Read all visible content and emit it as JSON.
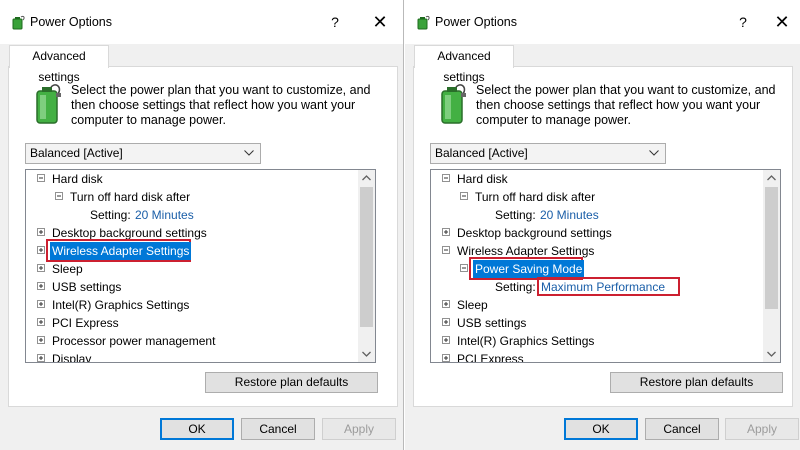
{
  "dialogs": [
    {
      "title": "Power Options",
      "help_label": "?",
      "close_label": "✕",
      "tab_label": "Advanced settings",
      "description": "Select the power plan that you want to customize, and then choose settings that reflect how you want your computer to manage power.",
      "plan_selected": "Balanced [Active]",
      "tree": [
        {
          "label": "Hard disk",
          "expander": "minus"
        },
        {
          "label": "Turn off hard disk after",
          "expander": "minus"
        },
        {
          "setting_prefix": "Setting:",
          "setting_value": "20 Minutes"
        },
        {
          "label": "Desktop background settings",
          "expander": "plus"
        },
        {
          "label": "Wireless Adapter Settings",
          "expander": "plus",
          "selected": true,
          "highlighted": true
        },
        {
          "label": "Sleep",
          "expander": "plus"
        },
        {
          "label": "USB settings",
          "expander": "plus"
        },
        {
          "label": "Intel(R) Graphics Settings",
          "expander": "plus"
        },
        {
          "label": "PCI Express",
          "expander": "plus"
        },
        {
          "label": "Processor power management",
          "expander": "plus"
        },
        {
          "label": "Display",
          "expander": "plus"
        }
      ],
      "restore_label": "Restore plan defaults",
      "ok_label": "OK",
      "cancel_label": "Cancel",
      "apply_label": "Apply"
    },
    {
      "title": "Power Options",
      "help_label": "?",
      "close_label": "✕",
      "tab_label": "Advanced settings",
      "description": "Select the power plan that you want to customize, and then choose settings that reflect how you want your computer to manage power.",
      "plan_selected": "Balanced [Active]",
      "tree": [
        {
          "label": "Hard disk",
          "expander": "minus"
        },
        {
          "label": "Turn off hard disk after",
          "expander": "minus"
        },
        {
          "setting_prefix": "Setting:",
          "setting_value": "20 Minutes"
        },
        {
          "label": "Desktop background settings",
          "expander": "plus"
        },
        {
          "label": "Wireless Adapter Settings",
          "expander": "minus"
        },
        {
          "label": "Power Saving Mode",
          "expander": "minus",
          "selected": true,
          "highlighted": true
        },
        {
          "setting_prefix": "Setting:",
          "setting_value": "Maximum Performance",
          "highlighted": true
        },
        {
          "label": "Sleep",
          "expander": "plus"
        },
        {
          "label": "USB settings",
          "expander": "plus"
        },
        {
          "label": "Intel(R) Graphics Settings",
          "expander": "plus"
        },
        {
          "label": "PCI Express",
          "expander": "plus"
        }
      ],
      "restore_label": "Restore plan defaults",
      "ok_label": "OK",
      "cancel_label": "Cancel",
      "apply_label": "Apply"
    }
  ],
  "colors": {
    "selection": "#0078d7",
    "highlight_border": "#cc2030",
    "setting_value": "#1a5ea8"
  }
}
